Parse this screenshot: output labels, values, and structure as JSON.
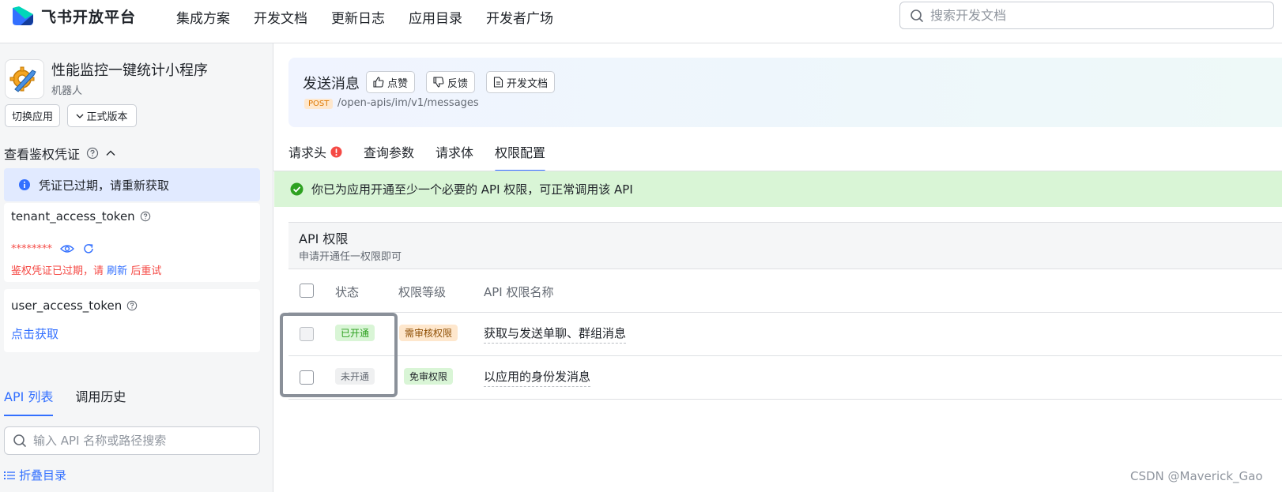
{
  "nav": {
    "logo_text": "飞书开放平台",
    "items": [
      "集成方案",
      "开发文档",
      "更新日志",
      "应用目录",
      "开发者广场"
    ],
    "search_placeholder": "搜索开发文档"
  },
  "sidebar": {
    "app_name": "性能监控一键统计小程序",
    "app_type": "机器人",
    "switch_app": "切换应用",
    "version": "正式版本",
    "cred_title": "查看鉴权凭证",
    "cred_alert": "凭证已过期，请重新获取",
    "tenant_token": {
      "name": "tenant_access_token",
      "masked": "********",
      "error_prefix": "鉴权凭证已过期，请",
      "error_link": "刷新",
      "error_suffix": "后重试"
    },
    "user_token": {
      "name": "user_access_token",
      "link": "点击获取"
    },
    "tabs": [
      "API 列表",
      "调用历史"
    ],
    "search_placeholder": "输入 API 名称或路径搜索",
    "collapse": "折叠目录"
  },
  "main": {
    "api_title": "发送消息",
    "buttons": {
      "like": "点赞",
      "feedback": "反馈",
      "docs": "开发文档"
    },
    "method": "POST",
    "path": "/open-apis/im/v1/messages",
    "tabs": [
      "请求头",
      "查询参数",
      "请求体",
      "权限配置"
    ],
    "success": "你已为应用开通至少一个必要的 API 权限，可正常调用该 API",
    "perm": {
      "title": "API 权限",
      "subtitle": "申请开通任一权限即可",
      "columns": [
        "状态",
        "权限等级",
        "API 权限名称"
      ],
      "rows": [
        {
          "status": "已开通",
          "level": "需审核权限",
          "name": "获取与发送单聊、群组消息"
        },
        {
          "status": "未开通",
          "level": "免审权限",
          "name": "以应用的身份发消息"
        }
      ]
    }
  },
  "watermark": "CSDN @Maverick_Gao",
  "colors": {
    "accent": "#3370ff",
    "success_bg": "#d9f5d6",
    "error": "#f54a45",
    "warning": "#de7802"
  }
}
